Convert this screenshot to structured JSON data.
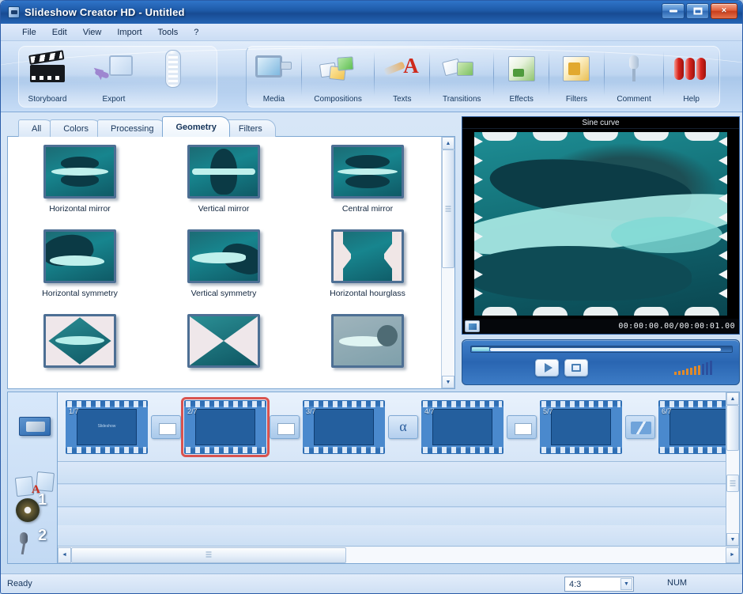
{
  "window": {
    "title": "Slideshow Creator HD - Untitled",
    "app_icon": "film-icon",
    "minimize": "–",
    "maximize": "□",
    "close": "×"
  },
  "menu": {
    "items": [
      {
        "label": "File"
      },
      {
        "label": "Edit"
      },
      {
        "label": "View"
      },
      {
        "label": "Import"
      },
      {
        "label": "Tools"
      },
      {
        "label": "?"
      }
    ]
  },
  "toolbar": {
    "group1": [
      {
        "label": "Storyboard",
        "icon": "clapperboard-icon"
      },
      {
        "label": "Export",
        "icon": "export-icon"
      }
    ],
    "group2": [
      {
        "label": "Media",
        "icon": "media-icon"
      },
      {
        "label": "Compositions",
        "icon": "compositions-icon"
      },
      {
        "label": "Texts",
        "icon": "texts-icon"
      },
      {
        "label": "Transitions",
        "icon": "transitions-icon"
      },
      {
        "label": "Effects",
        "icon": "effects-icon"
      },
      {
        "label": "Filters",
        "icon": "filters-icon"
      },
      {
        "label": "Comment",
        "icon": "microphone-icon"
      },
      {
        "label": "Help",
        "icon": "help-icon"
      }
    ]
  },
  "effects_panel": {
    "tabs": [
      {
        "label": "All",
        "active": false
      },
      {
        "label": "Colors",
        "active": false
      },
      {
        "label": "Processing",
        "active": false
      },
      {
        "label": "Geometry",
        "active": true
      },
      {
        "label": "Filters",
        "active": false
      }
    ],
    "items": [
      {
        "label": "Horizontal mirror"
      },
      {
        "label": "Vertical mirror"
      },
      {
        "label": "Central mirror"
      },
      {
        "label": "Horizontal symmetry"
      },
      {
        "label": "Vertical symmetry"
      },
      {
        "label": "Horizontal hourglass"
      },
      {
        "label": ""
      },
      {
        "label": ""
      },
      {
        "label": ""
      }
    ],
    "scroll_up": "▲",
    "scroll_down": "▼"
  },
  "preview": {
    "title": "Sine curve",
    "timecode": "00:00:00.00/00:00:01.00",
    "snapshot_icon": "snapshot-icon"
  },
  "transport": {
    "play_icon": "play-icon",
    "stop_icon": "stop-icon",
    "volume_icon": "volume-meter-icon",
    "seek_position_percent": 6
  },
  "timeline": {
    "track_icons": [
      {
        "name": "slides-track-icon"
      },
      {
        "name": "transitions-text-track-icon"
      },
      {
        "name": "audio-track-1-icon",
        "number": "1"
      },
      {
        "name": "audio-track-2-icon",
        "number": "2"
      }
    ],
    "slides": [
      {
        "num": "1/7",
        "kind": "title",
        "selected": false,
        "caption": "Slideshow"
      },
      {
        "num": "2/7",
        "kind": "flowers-white",
        "selected": true,
        "caption": ""
      },
      {
        "num": "3/7",
        "kind": "flowers-pink",
        "selected": false,
        "caption": ""
      },
      {
        "num": "4/7",
        "kind": "flowers-green",
        "selected": false,
        "caption": ""
      },
      {
        "num": "5/7",
        "kind": "flowers-purple",
        "selected": false,
        "caption": ""
      },
      {
        "num": "6/7",
        "kind": "flowers-red",
        "selected": false,
        "caption": ""
      }
    ],
    "transitions": [
      {
        "type": "fade",
        "icon": "transition-blank-icon"
      },
      {
        "type": "blank",
        "icon": "transition-blank-icon"
      },
      {
        "type": "alpha",
        "icon": "transition-alpha-icon"
      },
      {
        "type": "blank",
        "icon": "transition-blank-icon"
      },
      {
        "type": "wipe",
        "icon": "transition-wipe-icon"
      }
    ],
    "hscroll_left": "◄",
    "hscroll_right": "►",
    "vscroll_up": "▲",
    "vscroll_down": "▼"
  },
  "statusbar": {
    "status": "Ready",
    "aspect_ratio": "4:3",
    "aspect_arrow": "▼",
    "num_lock": "NUM"
  }
}
